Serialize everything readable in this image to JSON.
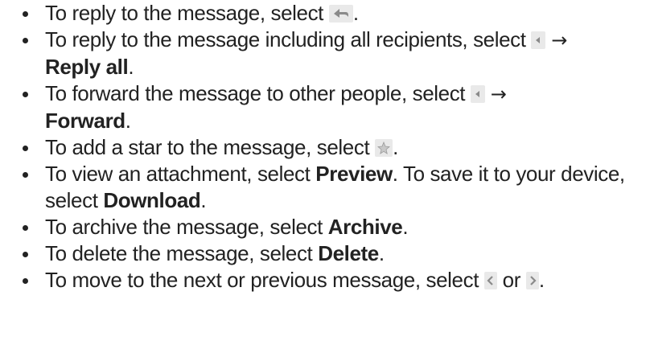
{
  "items": [
    {
      "text1": "To reply to the message, select ",
      "text2": "."
    },
    {
      "text1": "To reply to the message including all recipients, select ",
      "arrow": "→",
      "bold": "Reply all",
      "text2": "."
    },
    {
      "text1": "To forward the message to other people, select ",
      "arrow": "→",
      "bold": "Forward",
      "text2": "."
    },
    {
      "text1": "To add a star to the message, select ",
      "text2": "."
    },
    {
      "text1": "To view an attachment, select ",
      "bold1": "Preview",
      "text2": ". To save it to your device, select ",
      "bold2": "Download",
      "text3": "."
    },
    {
      "text1": "To archive the message, select ",
      "bold": "Archive",
      "text2": "."
    },
    {
      "text1": "To delete the message, select ",
      "bold": "Delete",
      "text2": "."
    },
    {
      "text1": "To move to the next or previous message, select ",
      "text2": " or ",
      "text3": "."
    }
  ],
  "icons": {
    "reply": "reply-icon",
    "menu": "overflow-menu-icon",
    "star": "star-icon",
    "previous": "chevron-left-icon",
    "next": "chevron-right-icon"
  },
  "colors": {
    "text": "#222222",
    "icon_bg": "#e9e9e9",
    "icon_glyph": "#8a8a8a"
  }
}
